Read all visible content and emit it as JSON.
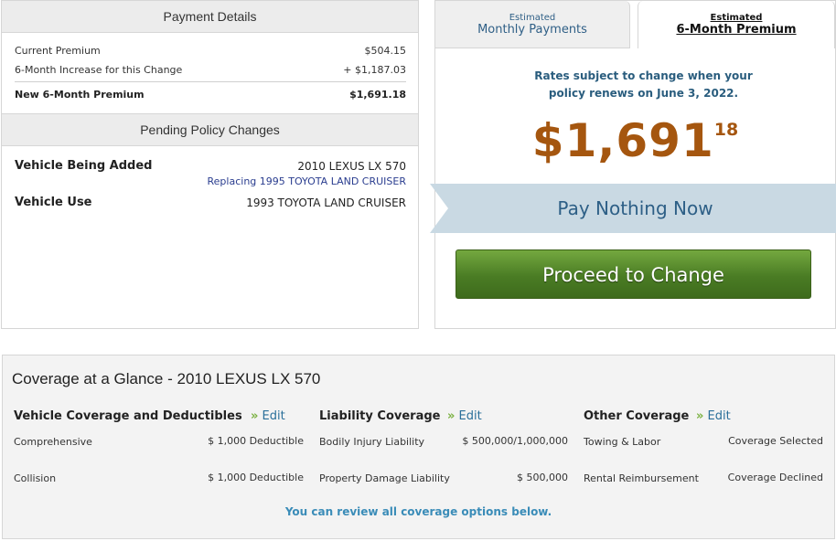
{
  "payment_details": {
    "title": "Payment Details",
    "current_premium_label": "Current Premium",
    "current_premium_value": "$504.15",
    "increase_label": "6-Month Increase for this Change",
    "increase_value": "+ $1,187.03",
    "new_premium_label": "New 6-Month Premium",
    "new_premium_value": "$1,691.18"
  },
  "pending_changes": {
    "title": "Pending Policy Changes",
    "vehicle_added_label": "Vehicle Being Added",
    "vehicle_added_value": "2010 LEXUS LX 570",
    "replacing_text": "Replacing 1995 TOYOTA LAND CRUISER",
    "vehicle_use_label": "Vehicle Use",
    "vehicle_use_value": "1993 TOYOTA LAND CRUISER"
  },
  "tabs": {
    "monthly_small": "Estimated",
    "monthly_big": "Monthly Payments",
    "six_small": "Estimated",
    "six_big": "6-Month Premium"
  },
  "premium": {
    "rates_note": "Rates subject to change when your policy renews on June 3, 2022.",
    "price_dollars": "$1,691",
    "price_cents": "18",
    "pay_banner": "Pay Nothing Now",
    "proceed_button": "Proceed to Change"
  },
  "coverage": {
    "title": "Coverage at a Glance - 2010 LEXUS LX 570",
    "edit_label": "Edit",
    "vehicle": {
      "heading": "Vehicle Coverage and Deductibles",
      "rows": [
        {
          "label": "Comprehensive",
          "value": "$ 1,000 Deductible"
        },
        {
          "label": "Collision",
          "value": "$ 1,000 Deductible"
        }
      ]
    },
    "liability": {
      "heading": "Liability Coverage",
      "rows": [
        {
          "label": "Bodily Injury Liability",
          "value": "$ 500,000/1,000,000"
        },
        {
          "label": "Property Damage Liability",
          "value": "$ 500,000"
        }
      ]
    },
    "other": {
      "heading": "Other Coverage",
      "rows": [
        {
          "label": "Towing & Labor",
          "value": "Coverage Selected"
        },
        {
          "label": "Rental Reimbursement",
          "value": "Coverage Declined"
        }
      ]
    },
    "review_note": "You can review all coverage options below."
  },
  "colors": {
    "price": "#a5560f",
    "banner": "#c9d9e3",
    "button": "#4a7c24",
    "link": "#2a6f9a"
  },
  "icons": [
    "double-chevron-right-icon"
  ]
}
